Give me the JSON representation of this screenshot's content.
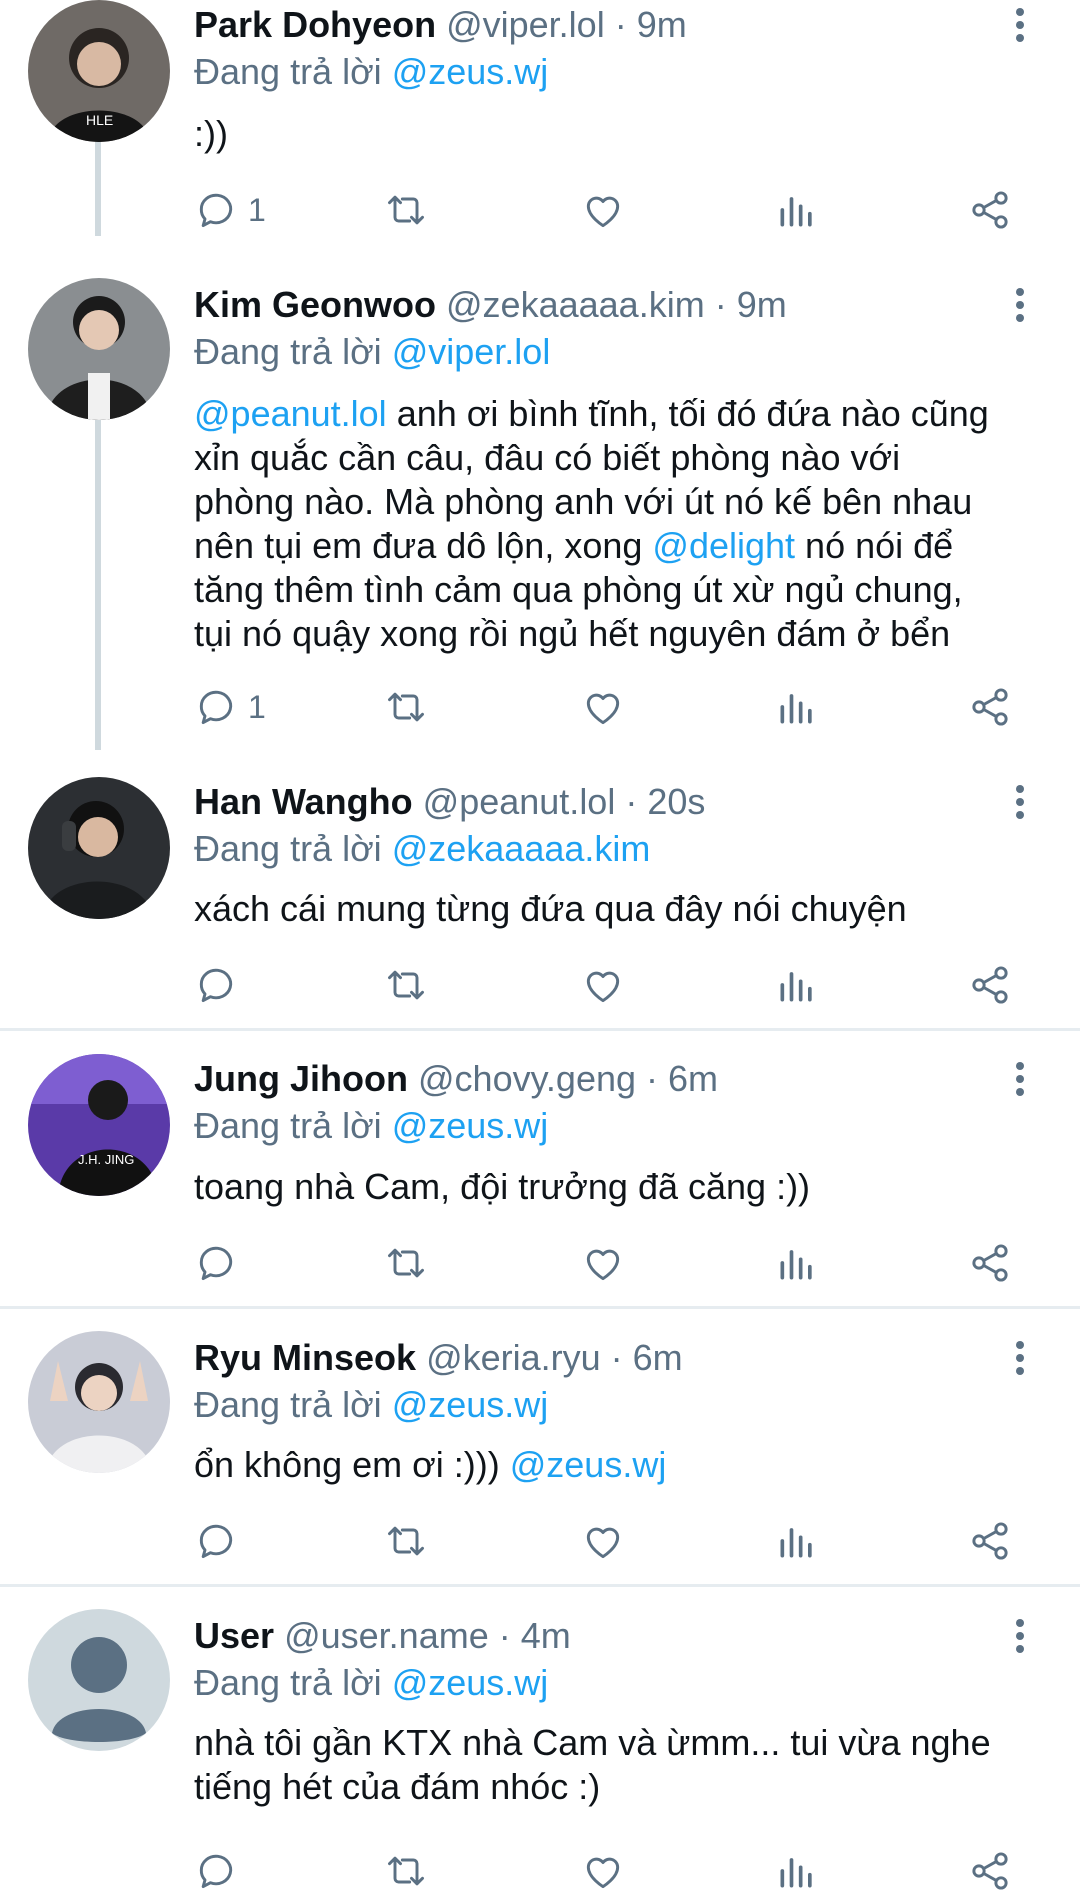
{
  "replying_prefix": "Đang trả lời",
  "tweets": [
    {
      "name": "Park Dohyeon",
      "handle": "@viper.lol",
      "time": "· 9m",
      "reply_to": "@zeus.wj",
      "body": [
        ":))"
      ],
      "reply_count": "1"
    },
    {
      "name": "Kim Geonwoo",
      "handle": "@zekaaaaa.kim",
      "time": "· 9m",
      "reply_to": "@viper.lol",
      "body": [
        {
          "mention": "@peanut.lol",
          "text": " anh ơi bình tĩnh, tối đó đứa nào cũng"
        },
        {
          "text": "xỉn quắc cần câu, đâu có biết phòng nào với"
        },
        {
          "text": "phòng nào. Mà phòng anh với út nó kế bên nhau"
        },
        {
          "text": "nên tụi em đưa dô lộn, xong ",
          "mention": "@delight",
          "text_after": " nó nói để"
        },
        {
          "text": "tăng thêm tình cảm qua phòng út xừ ngủ chung,"
        },
        {
          "text": "tụi nó quậy xong rồi ngủ hết nguyên đám ở bển"
        }
      ],
      "reply_count": "1"
    },
    {
      "name": "Han Wangho",
      "handle": "@peanut.lol",
      "time": "· 20s",
      "reply_to": "@zekaaaaa.kim",
      "body": [
        "xách cái mung từng đứa qua đây nói chuyện"
      ],
      "reply_count": ""
    },
    {
      "name": "Jung Jihoon",
      "handle": "@chovy.geng",
      "time": "· 6m",
      "reply_to": "@zeus.wj",
      "body": [
        "toang nhà Cam, đội trưởng đã căng :))"
      ],
      "reply_count": ""
    },
    {
      "name": "Ryu Minseok",
      "handle": "@keria.ryu",
      "time": "· 6m",
      "reply_to": "@zeus.wj",
      "body_text": "ổn không em ơi :))) ",
      "body_mention": "@zeus.wj",
      "reply_count": ""
    },
    {
      "name": "User",
      "handle": "@user.name",
      "time": "· 4m",
      "reply_to": "@zeus.wj",
      "body": [
        "nhà tôi gần KTX nhà Cam và ừmm... tui vừa nghe",
        "tiếng hét của đám nhóc :)"
      ],
      "reply_count": ""
    }
  ],
  "colors": {
    "accent": "#1da1f2",
    "secondary_text": "#5b7083",
    "divider": "#e6ecf0",
    "thread_line": "#cfd9de"
  },
  "icons": [
    "reply-icon",
    "retweet-icon",
    "like-icon",
    "analytics-icon",
    "share-icon",
    "more-icon",
    "default-avatar-icon"
  ]
}
